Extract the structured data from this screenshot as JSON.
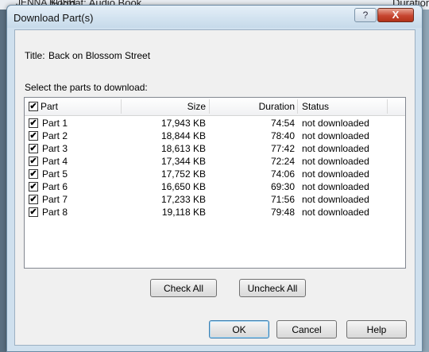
{
  "background": {
    "left_text": "JENNA BUSH",
    "mid_text": "Format: Audio Book",
    "right_text": "Duration"
  },
  "dialog": {
    "title": "Download Part(s)",
    "help_button": "?",
    "close_button": "X",
    "title_label": "Title:",
    "title_value": "Back on Blossom Street",
    "select_label": "Select the parts to download:"
  },
  "list": {
    "columns": {
      "part": "Part",
      "size": "Size",
      "duration": "Duration",
      "status": "Status"
    },
    "header_checked": true,
    "rows": [
      {
        "part": "Part 1",
        "size": "17,943 KB",
        "duration": "74:54",
        "status": "not downloaded",
        "checked": true
      },
      {
        "part": "Part 2",
        "size": "18,844 KB",
        "duration": "78:40",
        "status": "not downloaded",
        "checked": true
      },
      {
        "part": "Part 3",
        "size": "18,613 KB",
        "duration": "77:42",
        "status": "not downloaded",
        "checked": true
      },
      {
        "part": "Part 4",
        "size": "17,344 KB",
        "duration": "72:24",
        "status": "not downloaded",
        "checked": true
      },
      {
        "part": "Part 5",
        "size": "17,752 KB",
        "duration": "74:06",
        "status": "not downloaded",
        "checked": true
      },
      {
        "part": "Part 6",
        "size": "16,650 KB",
        "duration": "69:30",
        "status": "not downloaded",
        "checked": true
      },
      {
        "part": "Part 7",
        "size": "17,233 KB",
        "duration": "71:56",
        "status": "not downloaded",
        "checked": true
      },
      {
        "part": "Part 8",
        "size": "19,118 KB",
        "duration": "79:48",
        "status": "not downloaded",
        "checked": true
      }
    ]
  },
  "buttons": {
    "check_all": "Check All",
    "uncheck_all": "Uncheck All",
    "ok": "OK",
    "cancel": "Cancel",
    "help": "Help"
  }
}
